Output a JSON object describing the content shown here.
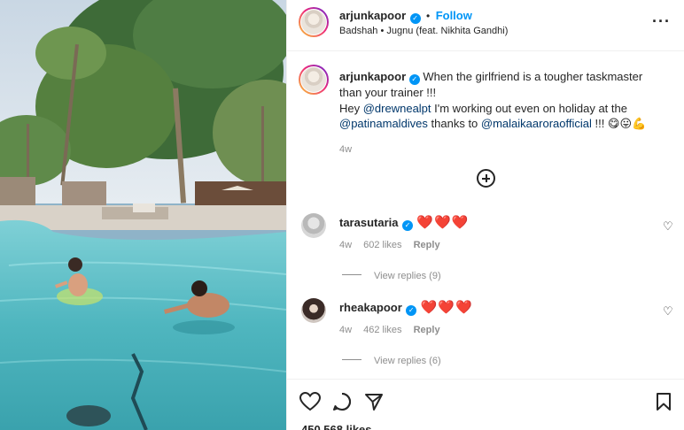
{
  "post": {
    "author": "arjunkapoor",
    "follow_label": "Follow",
    "separator": "•",
    "audio": "Badshah • Jugnu (feat. Nikhita Gandhi)"
  },
  "caption": {
    "username": "arjunkapoor",
    "line1": "When the girlfriend is a tougher taskmaster than your trainer !!!",
    "line2_prefix": "Hey ",
    "mention1": "@drewnealpt",
    "line2_suffix": " I'm working out even on holiday at the",
    "mention2": "@patinamaldives",
    "thanks_to": " thanks to ",
    "mention3": "@malaikaaroraofficial",
    "line3_suffix": " !!! 😋😛💪",
    "time": "4w"
  },
  "comments": [
    {
      "username": "tarasutaria",
      "text": "❤️❤️❤️",
      "time": "4w",
      "likes": "602 likes",
      "reply_label": "Reply",
      "view_replies": "View replies (9)"
    },
    {
      "username": "rheakapoor",
      "text": "❤️❤️❤️",
      "time": "4w",
      "likes": "462 likes",
      "reply_label": "Reply",
      "view_replies": "View replies (6)"
    }
  ],
  "footer": {
    "likes_count": "450,568 likes"
  },
  "icons": {
    "verified": "verified-badge-icon",
    "more": "more-options-icon",
    "plus": "load-more-comments-icon",
    "heart": "heart-icon",
    "comment": "comment-icon",
    "share": "share-icon",
    "save": "bookmark-icon"
  },
  "colors": {
    "accent": "#0095f6",
    "mention": "#00376b",
    "muted": "#8e8e8e",
    "text": "#262626"
  }
}
